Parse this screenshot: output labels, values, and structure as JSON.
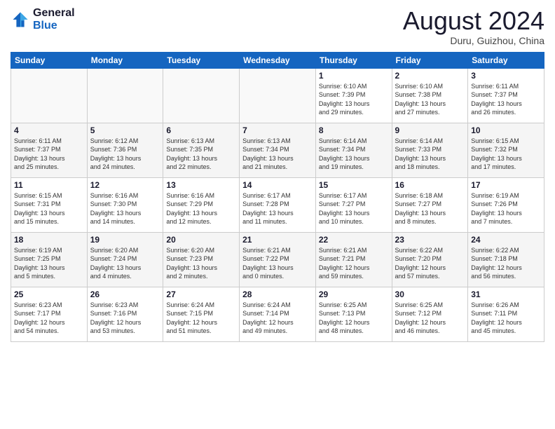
{
  "logo": {
    "line1": "General",
    "line2": "Blue"
  },
  "title": "August 2024",
  "subtitle": "Duru, Guizhou, China",
  "weekdays": [
    "Sunday",
    "Monday",
    "Tuesday",
    "Wednesday",
    "Thursday",
    "Friday",
    "Saturday"
  ],
  "weeks": [
    [
      {
        "day": "",
        "info": ""
      },
      {
        "day": "",
        "info": ""
      },
      {
        "day": "",
        "info": ""
      },
      {
        "day": "",
        "info": ""
      },
      {
        "day": "1",
        "info": "Sunrise: 6:10 AM\nSunset: 7:39 PM\nDaylight: 13 hours\nand 29 minutes."
      },
      {
        "day": "2",
        "info": "Sunrise: 6:10 AM\nSunset: 7:38 PM\nDaylight: 13 hours\nand 27 minutes."
      },
      {
        "day": "3",
        "info": "Sunrise: 6:11 AM\nSunset: 7:37 PM\nDaylight: 13 hours\nand 26 minutes."
      }
    ],
    [
      {
        "day": "4",
        "info": "Sunrise: 6:11 AM\nSunset: 7:37 PM\nDaylight: 13 hours\nand 25 minutes."
      },
      {
        "day": "5",
        "info": "Sunrise: 6:12 AM\nSunset: 7:36 PM\nDaylight: 13 hours\nand 24 minutes."
      },
      {
        "day": "6",
        "info": "Sunrise: 6:13 AM\nSunset: 7:35 PM\nDaylight: 13 hours\nand 22 minutes."
      },
      {
        "day": "7",
        "info": "Sunrise: 6:13 AM\nSunset: 7:34 PM\nDaylight: 13 hours\nand 21 minutes."
      },
      {
        "day": "8",
        "info": "Sunrise: 6:14 AM\nSunset: 7:34 PM\nDaylight: 13 hours\nand 19 minutes."
      },
      {
        "day": "9",
        "info": "Sunrise: 6:14 AM\nSunset: 7:33 PM\nDaylight: 13 hours\nand 18 minutes."
      },
      {
        "day": "10",
        "info": "Sunrise: 6:15 AM\nSunset: 7:32 PM\nDaylight: 13 hours\nand 17 minutes."
      }
    ],
    [
      {
        "day": "11",
        "info": "Sunrise: 6:15 AM\nSunset: 7:31 PM\nDaylight: 13 hours\nand 15 minutes."
      },
      {
        "day": "12",
        "info": "Sunrise: 6:16 AM\nSunset: 7:30 PM\nDaylight: 13 hours\nand 14 minutes."
      },
      {
        "day": "13",
        "info": "Sunrise: 6:16 AM\nSunset: 7:29 PM\nDaylight: 13 hours\nand 12 minutes."
      },
      {
        "day": "14",
        "info": "Sunrise: 6:17 AM\nSunset: 7:28 PM\nDaylight: 13 hours\nand 11 minutes."
      },
      {
        "day": "15",
        "info": "Sunrise: 6:17 AM\nSunset: 7:27 PM\nDaylight: 13 hours\nand 10 minutes."
      },
      {
        "day": "16",
        "info": "Sunrise: 6:18 AM\nSunset: 7:27 PM\nDaylight: 13 hours\nand 8 minutes."
      },
      {
        "day": "17",
        "info": "Sunrise: 6:19 AM\nSunset: 7:26 PM\nDaylight: 13 hours\nand 7 minutes."
      }
    ],
    [
      {
        "day": "18",
        "info": "Sunrise: 6:19 AM\nSunset: 7:25 PM\nDaylight: 13 hours\nand 5 minutes."
      },
      {
        "day": "19",
        "info": "Sunrise: 6:20 AM\nSunset: 7:24 PM\nDaylight: 13 hours\nand 4 minutes."
      },
      {
        "day": "20",
        "info": "Sunrise: 6:20 AM\nSunset: 7:23 PM\nDaylight: 13 hours\nand 2 minutes."
      },
      {
        "day": "21",
        "info": "Sunrise: 6:21 AM\nSunset: 7:22 PM\nDaylight: 13 hours\nand 0 minutes."
      },
      {
        "day": "22",
        "info": "Sunrise: 6:21 AM\nSunset: 7:21 PM\nDaylight: 12 hours\nand 59 minutes."
      },
      {
        "day": "23",
        "info": "Sunrise: 6:22 AM\nSunset: 7:20 PM\nDaylight: 12 hours\nand 57 minutes."
      },
      {
        "day": "24",
        "info": "Sunrise: 6:22 AM\nSunset: 7:18 PM\nDaylight: 12 hours\nand 56 minutes."
      }
    ],
    [
      {
        "day": "25",
        "info": "Sunrise: 6:23 AM\nSunset: 7:17 PM\nDaylight: 12 hours\nand 54 minutes."
      },
      {
        "day": "26",
        "info": "Sunrise: 6:23 AM\nSunset: 7:16 PM\nDaylight: 12 hours\nand 53 minutes."
      },
      {
        "day": "27",
        "info": "Sunrise: 6:24 AM\nSunset: 7:15 PM\nDaylight: 12 hours\nand 51 minutes."
      },
      {
        "day": "28",
        "info": "Sunrise: 6:24 AM\nSunset: 7:14 PM\nDaylight: 12 hours\nand 49 minutes."
      },
      {
        "day": "29",
        "info": "Sunrise: 6:25 AM\nSunset: 7:13 PM\nDaylight: 12 hours\nand 48 minutes."
      },
      {
        "day": "30",
        "info": "Sunrise: 6:25 AM\nSunset: 7:12 PM\nDaylight: 12 hours\nand 46 minutes."
      },
      {
        "day": "31",
        "info": "Sunrise: 6:26 AM\nSunset: 7:11 PM\nDaylight: 12 hours\nand 45 minutes."
      }
    ]
  ]
}
